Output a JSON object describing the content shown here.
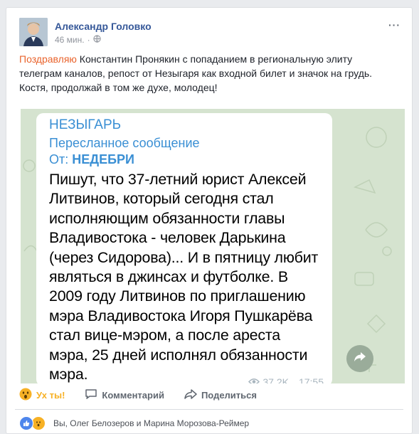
{
  "post": {
    "author": "Александр Головко",
    "time": "46 мин.",
    "privacy_icon": "globe-icon",
    "more_label": "···",
    "text": {
      "mention1": "Поздравляю",
      "part1": " Константин Пронякин с попаданием в региональную элиту телеграм каналов, репост от Незыгаря как входной билет и значок на грудь. Костя, продолжай в том же духе, молодец!"
    }
  },
  "telegram": {
    "channel": "НЕЗЫГАРЬ",
    "forwarded": "Пересланное сообщение",
    "from_prefix": "От: ",
    "from_name": "НЕДЕБРИ",
    "body": "Пишут, что 37-летний юрист Алексей Литвинов, который сегодня стал исполняющим обязанности главы Владивостока - человек Дарькина (через Сидорова)... И в пятницу любит являться в джинсах и футболке. В 2009 году Литвинов по приглашению мэра Владивостока Игоря Пушкарёва стал вице-мэром, а после ареста мэра, 25 дней исполнял обязанности мэра.",
    "views": "37.2K",
    "time": "17:55"
  },
  "actions": {
    "wow": "Ух ты!",
    "comment": "Комментарий",
    "share": "Поделиться"
  },
  "reactions": {
    "summary": "Вы, Олег Белозеров и Марина Морозова-Реймер"
  },
  "colors": {
    "link": "#365899",
    "mention": "#e9632c",
    "telegram_blue": "#3a8fd4",
    "wow": "#f7b125"
  }
}
